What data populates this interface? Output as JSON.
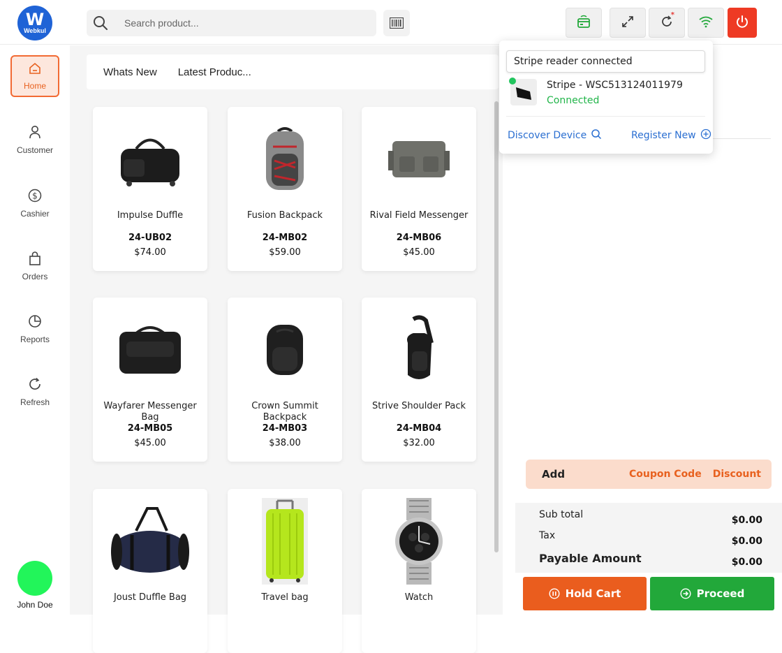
{
  "brand": {
    "logo_letter": "W",
    "logo_text": "Webkul"
  },
  "search": {
    "placeholder": "Search product..."
  },
  "sidebar": {
    "items": [
      {
        "label": "Home"
      },
      {
        "label": "Customer"
      },
      {
        "label": "Cashier"
      },
      {
        "label": "Orders"
      },
      {
        "label": "Reports"
      },
      {
        "label": "Refresh"
      }
    ],
    "user": {
      "name": "John Doe"
    }
  },
  "tabs": [
    {
      "label": "Whats New"
    },
    {
      "label": "Latest Produc..."
    }
  ],
  "products": [
    {
      "name": "Impulse Duffle",
      "sku": "24-UB02",
      "price": "$74.00"
    },
    {
      "name": "Fusion Backpack",
      "sku": "24-MB02",
      "price": "$59.00"
    },
    {
      "name": "Rival Field Messenger",
      "sku": "24-MB06",
      "price": "$45.00"
    },
    {
      "name": "Wayfarer Messenger Bag",
      "sku": "24-MB05",
      "price": "$45.00"
    },
    {
      "name": "Crown Summit Backpack",
      "sku": "24-MB03",
      "price": "$38.00"
    },
    {
      "name": "Strive Shoulder Pack",
      "sku": "24-MB04",
      "price": "$32.00"
    },
    {
      "name": "Joust Duffle Bag",
      "sku": "",
      "price": ""
    },
    {
      "name": "Travel bag",
      "sku": "",
      "price": ""
    },
    {
      "name": "Watch",
      "sku": "",
      "price": ""
    }
  ],
  "stripe_popover": {
    "heading": "Stripe reader connected",
    "device_name": "Stripe - WSC513124011979",
    "status": "Connected",
    "discover_label": "Discover Device",
    "register_label": "Register New"
  },
  "cart": {
    "add_label": "Add",
    "coupon_label": "Coupon Code",
    "discount_label": "Discount",
    "subtotal_label": "Sub total",
    "subtotal_value": "$0.00",
    "tax_label": "Tax",
    "tax_value": "$0.00",
    "payable_label": "Payable Amount",
    "payable_value": "$0.00",
    "hold_label": "Hold Cart",
    "proceed_label": "Proceed"
  },
  "colors": {
    "accent": "#e8611f",
    "power": "#ee3a24",
    "proceed": "#22a83a",
    "brand": "#1f63d6",
    "connected": "#22b54a",
    "link": "#2b6fd1"
  },
  "icons": [
    "search-icon",
    "barcode-icon",
    "card-reader-icon",
    "fullscreen-icon",
    "sync-icon",
    "wifi-icon",
    "power-icon",
    "home-icon",
    "user-icon",
    "dollar-icon",
    "bag-icon",
    "pie-chart-icon",
    "refresh-icon",
    "pause-icon",
    "arrow-right-circle-icon",
    "plus-circle-icon"
  ]
}
